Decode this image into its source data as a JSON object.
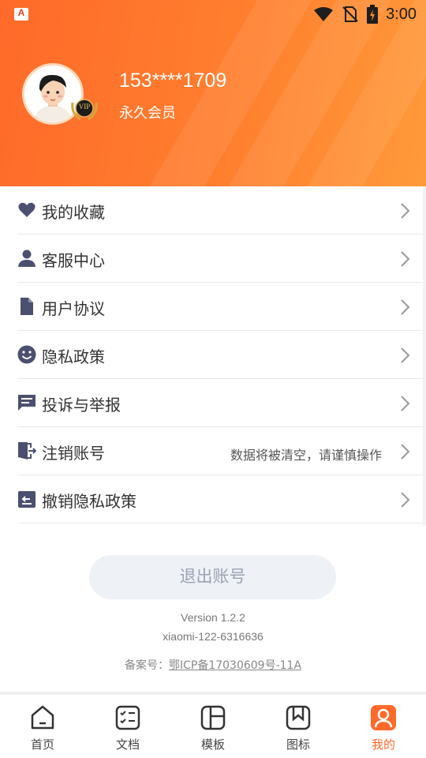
{
  "status_bar": {
    "time": "3:00",
    "icons": [
      "app-notification-icon",
      "wifi-icon",
      "no-sim-icon",
      "battery-charging-icon"
    ]
  },
  "profile": {
    "phone": "153****1709",
    "membership": "永久会员",
    "badge_text": "VIP"
  },
  "menu": {
    "items": [
      {
        "label": "我的收藏",
        "icon": "heart-icon",
        "note": ""
      },
      {
        "label": "客服中心",
        "icon": "person-icon",
        "note": ""
      },
      {
        "label": "用户协议",
        "icon": "document-icon",
        "note": ""
      },
      {
        "label": "隐私政策",
        "icon": "smiley-icon",
        "note": ""
      },
      {
        "label": "投诉与举报",
        "icon": "message-icon",
        "note": ""
      },
      {
        "label": "注销账号",
        "icon": "exit-door-icon",
        "note": "数据将被清空，请谨慎操作"
      },
      {
        "label": "撤销隐私政策",
        "icon": "revoke-icon",
        "note": ""
      }
    ]
  },
  "logout_label": "退出账号",
  "footer": {
    "version": "Version 1.2.2",
    "build": "xiaomi-122-6316636",
    "icp_prefix": "备案号：",
    "icp_link": "鄂ICP备17030609号-11A"
  },
  "tabs": [
    {
      "label": "首页",
      "icon": "home-icon",
      "active": false
    },
    {
      "label": "文档",
      "icon": "checklist-icon",
      "active": false
    },
    {
      "label": "模板",
      "icon": "layout-icon",
      "active": false
    },
    {
      "label": "图标",
      "icon": "bookmark-icon",
      "active": false
    },
    {
      "label": "我的",
      "icon": "profile-icon",
      "active": true
    }
  ],
  "colors": {
    "accent": "#ff6a2a",
    "menu_icon": "#4b5070",
    "logout_bg": "#eef1f6"
  }
}
